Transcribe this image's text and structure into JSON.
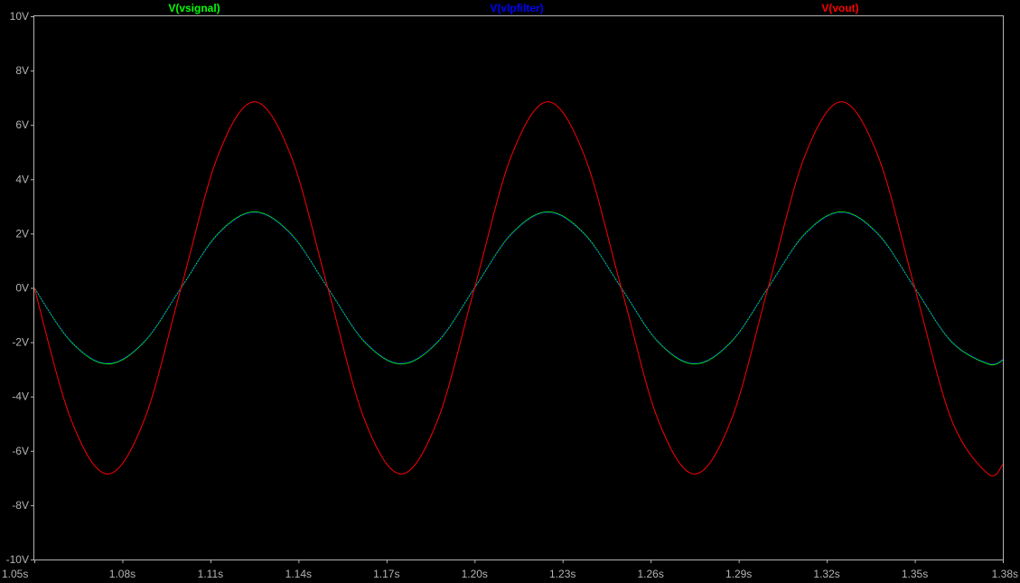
{
  "chart_data": {
    "type": "line",
    "title": "",
    "xlabel": "",
    "ylabel": "",
    "xlim": [
      1.05,
      1.38
    ],
    "ylim": [
      -10,
      10
    ],
    "grid": false,
    "legend_placement": "top",
    "background": "#000000",
    "axis_color": "#b4b4b4",
    "x_ticks": [
      {
        "value": 1.05,
        "label": "1.05s"
      },
      {
        "value": 1.08,
        "label": "1.08s"
      },
      {
        "value": 1.11,
        "label": "1.11s"
      },
      {
        "value": 1.14,
        "label": "1.14s"
      },
      {
        "value": 1.17,
        "label": "1.17s"
      },
      {
        "value": 1.2,
        "label": "1.20s"
      },
      {
        "value": 1.23,
        "label": "1.23s"
      },
      {
        "value": 1.26,
        "label": "1.26s"
      },
      {
        "value": 1.29,
        "label": "1.29s"
      },
      {
        "value": 1.32,
        "label": "1.32s"
      },
      {
        "value": 1.35,
        "label": "1.35s"
      },
      {
        "value": 1.38,
        "label": "1.38s"
      }
    ],
    "y_ticks": [
      {
        "value": 10,
        "label": "10V"
      },
      {
        "value": 8,
        "label": "8V"
      },
      {
        "value": 6,
        "label": "6V"
      },
      {
        "value": 4,
        "label": "4V"
      },
      {
        "value": 2,
        "label": "2V"
      },
      {
        "value": 0,
        "label": "0V"
      },
      {
        "value": -2,
        "label": "-2V"
      },
      {
        "value": -4,
        "label": "-4V"
      },
      {
        "value": -6,
        "label": "-6V"
      },
      {
        "value": -8,
        "label": "-8V"
      },
      {
        "value": -10,
        "label": "-10V"
      }
    ],
    "series": [
      {
        "name": "V(vsignal)",
        "color": "#00ff00",
        "x": [
          1.05,
          1.0625,
          1.075,
          1.0875,
          1.1,
          1.1125,
          1.125,
          1.1375,
          1.15,
          1.1625,
          1.175,
          1.1875,
          1.2,
          1.2125,
          1.225,
          1.2375,
          1.25,
          1.2625,
          1.275,
          1.2875,
          1.3,
          1.3125,
          1.325,
          1.3375,
          1.35,
          1.3625,
          1.375,
          1.38
        ],
        "y": [
          0,
          -1.98,
          -2.8,
          -1.98,
          0,
          1.98,
          2.8,
          1.98,
          0,
          -1.98,
          -2.8,
          -1.98,
          0,
          1.98,
          2.8,
          1.98,
          0,
          -1.98,
          -2.8,
          -1.98,
          0,
          1.98,
          2.8,
          1.98,
          0,
          -1.98,
          -2.8,
          -2.66
        ]
      },
      {
        "name": "V(vlpfilter)",
        "color": "#0000ff",
        "x": [
          1.05,
          1.0625,
          1.075,
          1.0875,
          1.1,
          1.1125,
          1.125,
          1.1375,
          1.15,
          1.1625,
          1.175,
          1.1875,
          1.2,
          1.2125,
          1.225,
          1.2375,
          1.25,
          1.2625,
          1.275,
          1.2875,
          1.3,
          1.3125,
          1.325,
          1.3375,
          1.35,
          1.3625,
          1.375,
          1.38
        ],
        "y": [
          0,
          -1.96,
          -2.77,
          -1.96,
          0,
          1.96,
          2.77,
          1.96,
          0,
          -1.96,
          -2.77,
          -1.96,
          0,
          1.96,
          2.77,
          1.96,
          0,
          -1.96,
          -2.77,
          -1.96,
          0,
          1.96,
          2.77,
          1.96,
          0,
          -1.96,
          -2.77,
          -2.63
        ]
      },
      {
        "name": "V(vout)",
        "color": "#ff0000",
        "x": [
          1.05,
          1.0625,
          1.075,
          1.0875,
          1.1,
          1.1125,
          1.125,
          1.1375,
          1.15,
          1.1625,
          1.175,
          1.1875,
          1.2,
          1.2125,
          1.225,
          1.2375,
          1.25,
          1.2625,
          1.275,
          1.2875,
          1.3,
          1.3125,
          1.325,
          1.3375,
          1.35,
          1.3625,
          1.375,
          1.38
        ],
        "y": [
          0,
          -4.85,
          -6.85,
          -4.85,
          0,
          4.85,
          6.85,
          4.85,
          0,
          -4.85,
          -6.85,
          -4.85,
          0,
          4.85,
          6.85,
          4.85,
          0,
          -4.85,
          -6.85,
          -4.85,
          0,
          4.85,
          6.85,
          4.85,
          0,
          -4.85,
          -6.85,
          -6.5
        ]
      }
    ]
  }
}
